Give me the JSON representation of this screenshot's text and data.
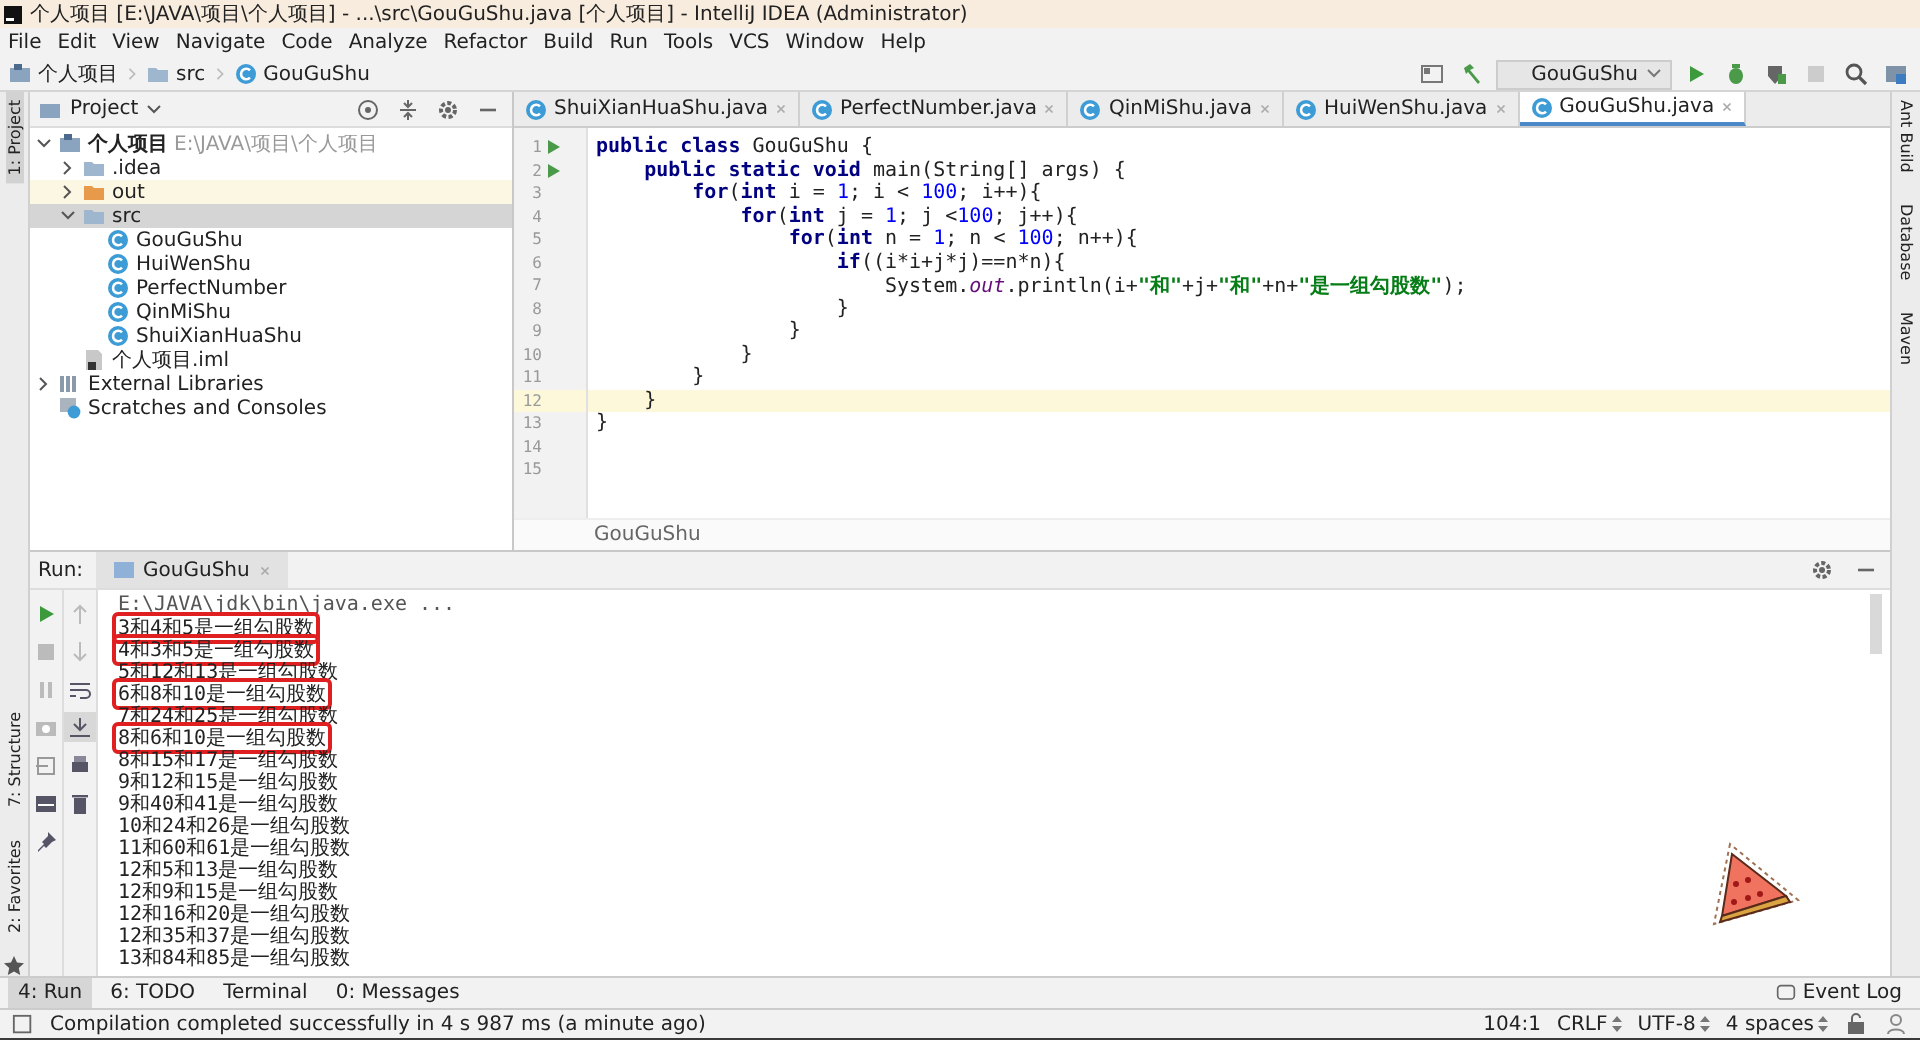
{
  "window": {
    "title": "个人项目 [E:\\JAVA\\项目\\个人项目] - ...\\src\\GouGuShu.java [个人项目] - IntelliJ IDEA (Administrator)"
  },
  "menu": [
    "File",
    "Edit",
    "View",
    "Navigate",
    "Code",
    "Analyze",
    "Refactor",
    "Build",
    "Run",
    "Tools",
    "VCS",
    "Window",
    "Help"
  ],
  "navbar": {
    "crumbs": [
      {
        "label": "个人项目",
        "kind": "module"
      },
      {
        "label": "src",
        "kind": "folder"
      },
      {
        "label": "GouGuShu",
        "kind": "class"
      }
    ],
    "run_config": "GouGuShu"
  },
  "left_stripe": [
    {
      "label": "1: Project",
      "selected": true
    },
    {
      "label": "7: Structure",
      "selected": false
    },
    {
      "label": "2: Favorites",
      "selected": false
    }
  ],
  "right_stripe": [
    "Ant Build",
    "Database",
    "Maven"
  ],
  "project": {
    "title": "Project",
    "tree": [
      {
        "label": "个人项目",
        "path": "E:\\JAVA\\项目\\个人项目",
        "kind": "module",
        "expanded": true,
        "selected": false,
        "children": [
          {
            "label": ".idea",
            "kind": "folder",
            "expanded": false,
            "selected": false
          },
          {
            "label": "out",
            "kind": "excluded",
            "expanded": false,
            "selected": false
          },
          {
            "label": "src",
            "kind": "folder",
            "expanded": true,
            "selected": true,
            "children": [
              {
                "label": "GouGuShu",
                "kind": "class",
                "selected": false
              },
              {
                "label": "HuiWenShu",
                "kind": "class",
                "selected": false
              },
              {
                "label": "PerfectNumber",
                "kind": "class",
                "selected": false
              },
              {
                "label": "QinMiShu",
                "kind": "class",
                "selected": false
              },
              {
                "label": "ShuiXianHuaShu",
                "kind": "class",
                "selected": false
              }
            ]
          },
          {
            "label": "个人项目.iml",
            "kind": "iml",
            "selected": false
          }
        ]
      },
      {
        "label": "External Libraries",
        "kind": "library",
        "expanded": false,
        "selected": false
      },
      {
        "label": "Scratches and Consoles",
        "kind": "scratches",
        "selected": false
      }
    ]
  },
  "editor": {
    "tabs": [
      {
        "label": "ShuiXianHuaShu.java",
        "selected": false
      },
      {
        "label": "PerfectNumber.java",
        "selected": false
      },
      {
        "label": "QinMiShu.java",
        "selected": false
      },
      {
        "label": "HuiWenShu.java",
        "selected": false
      },
      {
        "label": "GouGuShu.java",
        "selected": true
      }
    ],
    "lines": [
      {
        "number": "1",
        "runnable": true,
        "current": false,
        "tokens": [
          {
            "text": "public class",
            "kind": "kw"
          },
          {
            "text": " GouGuShu {",
            "kind": "plain"
          }
        ]
      },
      {
        "number": "2",
        "runnable": true,
        "current": false,
        "tokens": [
          {
            "text": "    public static void",
            "kind": "kw"
          },
          {
            "text": " main(String[] args) {",
            "kind": "plain"
          }
        ]
      },
      {
        "number": "3",
        "runnable": false,
        "current": false,
        "tokens": [
          {
            "text": "        for",
            "kind": "kw"
          },
          {
            "text": "(",
            "kind": "plain"
          },
          {
            "text": "int",
            "kind": "kw"
          },
          {
            "text": " i = ",
            "kind": "plain"
          },
          {
            "text": "1",
            "kind": "num"
          },
          {
            "text": "; i < ",
            "kind": "plain"
          },
          {
            "text": "100",
            "kind": "num"
          },
          {
            "text": "; i++){",
            "kind": "plain"
          }
        ]
      },
      {
        "number": "4",
        "runnable": false,
        "current": false,
        "tokens": [
          {
            "text": "            for",
            "kind": "kw"
          },
          {
            "text": "(",
            "kind": "plain"
          },
          {
            "text": "int",
            "kind": "kw"
          },
          {
            "text": " j = ",
            "kind": "plain"
          },
          {
            "text": "1",
            "kind": "num"
          },
          {
            "text": "; j <",
            "kind": "plain"
          },
          {
            "text": "100",
            "kind": "num"
          },
          {
            "text": "; j++){",
            "kind": "plain"
          }
        ]
      },
      {
        "number": "5",
        "runnable": false,
        "current": false,
        "tokens": [
          {
            "text": "                for",
            "kind": "kw"
          },
          {
            "text": "(",
            "kind": "plain"
          },
          {
            "text": "int",
            "kind": "kw"
          },
          {
            "text": " n = ",
            "kind": "plain"
          },
          {
            "text": "1",
            "kind": "num"
          },
          {
            "text": "; n < ",
            "kind": "plain"
          },
          {
            "text": "100",
            "kind": "num"
          },
          {
            "text": "; n++){",
            "kind": "plain"
          }
        ]
      },
      {
        "number": "6",
        "runnable": false,
        "current": false,
        "tokens": [
          {
            "text": "                    if",
            "kind": "kw"
          },
          {
            "text": "((i*i+j*j)==n*n){",
            "kind": "plain"
          }
        ]
      },
      {
        "number": "7",
        "runnable": false,
        "current": false,
        "tokens": [
          {
            "text": "                        System.",
            "kind": "plain"
          },
          {
            "text": "out",
            "kind": "field"
          },
          {
            "text": ".println(i+",
            "kind": "plain"
          },
          {
            "text": "\"和\"",
            "kind": "str"
          },
          {
            "text": "+j+",
            "kind": "plain"
          },
          {
            "text": "\"和\"",
            "kind": "str"
          },
          {
            "text": "+n+",
            "kind": "plain"
          },
          {
            "text": "\"是一组勾股数\"",
            "kind": "str"
          },
          {
            "text": ");",
            "kind": "plain"
          }
        ]
      },
      {
        "number": "8",
        "runnable": false,
        "current": false,
        "tokens": [
          {
            "text": "                    }",
            "kind": "plain"
          }
        ]
      },
      {
        "number": "9",
        "runnable": false,
        "current": false,
        "tokens": [
          {
            "text": "                }",
            "kind": "plain"
          }
        ]
      },
      {
        "number": "10",
        "runnable": false,
        "current": false,
        "tokens": [
          {
            "text": "            }",
            "kind": "plain"
          }
        ]
      },
      {
        "number": "11",
        "runnable": false,
        "current": false,
        "tokens": [
          {
            "text": "        }",
            "kind": "plain"
          }
        ]
      },
      {
        "number": "12",
        "runnable": false,
        "current": true,
        "tokens": [
          {
            "text": "    }",
            "kind": "plain"
          }
        ]
      },
      {
        "number": "13",
        "runnable": false,
        "current": false,
        "tokens": [
          {
            "text": "}",
            "kind": "plain"
          }
        ]
      },
      {
        "number": "14",
        "runnable": false,
        "current": false
      },
      {
        "number": "15",
        "runnable": false,
        "current": false
      }
    ],
    "breadcrumb": "GouGuShu"
  },
  "run": {
    "label": "Run:",
    "tab": "GouGuShu",
    "command": "E:\\JAVA\\jdk\\bin\\java.exe ...",
    "output": [
      {
        "text": "3和4和5是一组勾股数",
        "boxed": true
      },
      {
        "text": "4和3和5是一组勾股数",
        "boxed": true
      },
      {
        "text": "5和12和13是一组勾股数",
        "boxed": false
      },
      {
        "text": "6和8和10是一组勾股数",
        "boxed": true
      },
      {
        "text": "7和24和25是一组勾股数",
        "boxed": false
      },
      {
        "text": "8和6和10是一组勾股数",
        "boxed": true
      },
      {
        "text": "8和15和17是一组勾股数",
        "boxed": false
      },
      {
        "text": "9和12和15是一组勾股数",
        "boxed": false
      },
      {
        "text": "9和40和41是一组勾股数",
        "boxed": false
      },
      {
        "text": "10和24和26是一组勾股数",
        "boxed": false
      },
      {
        "text": "11和60和61是一组勾股数",
        "boxed": false
      },
      {
        "text": "12和5和13是一组勾股数",
        "boxed": false
      },
      {
        "text": "12和9和15是一组勾股数",
        "boxed": false
      },
      {
        "text": "12和16和20是一组勾股数",
        "boxed": false
      },
      {
        "text": "12和35和37是一组勾股数",
        "boxed": false
      },
      {
        "text": "13和84和85是一组勾股数",
        "boxed": false
      }
    ]
  },
  "tool_tabs": [
    {
      "label": "4: Run",
      "selected": true
    },
    {
      "label": "6: TODO",
      "selected": false
    },
    {
      "label": "Terminal",
      "selected": false
    },
    {
      "label": "0: Messages",
      "selected": false
    }
  ],
  "event_log": "Event Log",
  "status_bar": {
    "message": "Compilation completed successfully in 4 s 987 ms (a minute ago)",
    "position": "104:1",
    "line_ending": "CRLF",
    "encoding": "UTF-8",
    "indent": "4 spaces"
  }
}
